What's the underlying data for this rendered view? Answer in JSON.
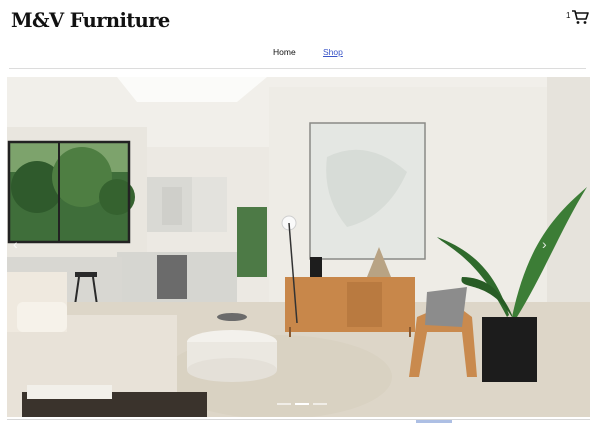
{
  "header": {
    "brand": "M&V Furniture",
    "cart_count": "1",
    "cart_icon": "shopping-cart-icon"
  },
  "nav": {
    "items": [
      {
        "label": "Home",
        "active": false
      },
      {
        "label": "Shop",
        "active": true
      }
    ]
  },
  "hero": {
    "image_subject": "modern living room with kitchen",
    "slide_count": 3,
    "active_slide": 2,
    "prev_icon": "chevron-left-icon",
    "next_icon": "chevron-right-icon"
  },
  "colors": {
    "brand_text": "#111111",
    "active_link": "#3a55c8",
    "divider": "#dcdcdc"
  }
}
